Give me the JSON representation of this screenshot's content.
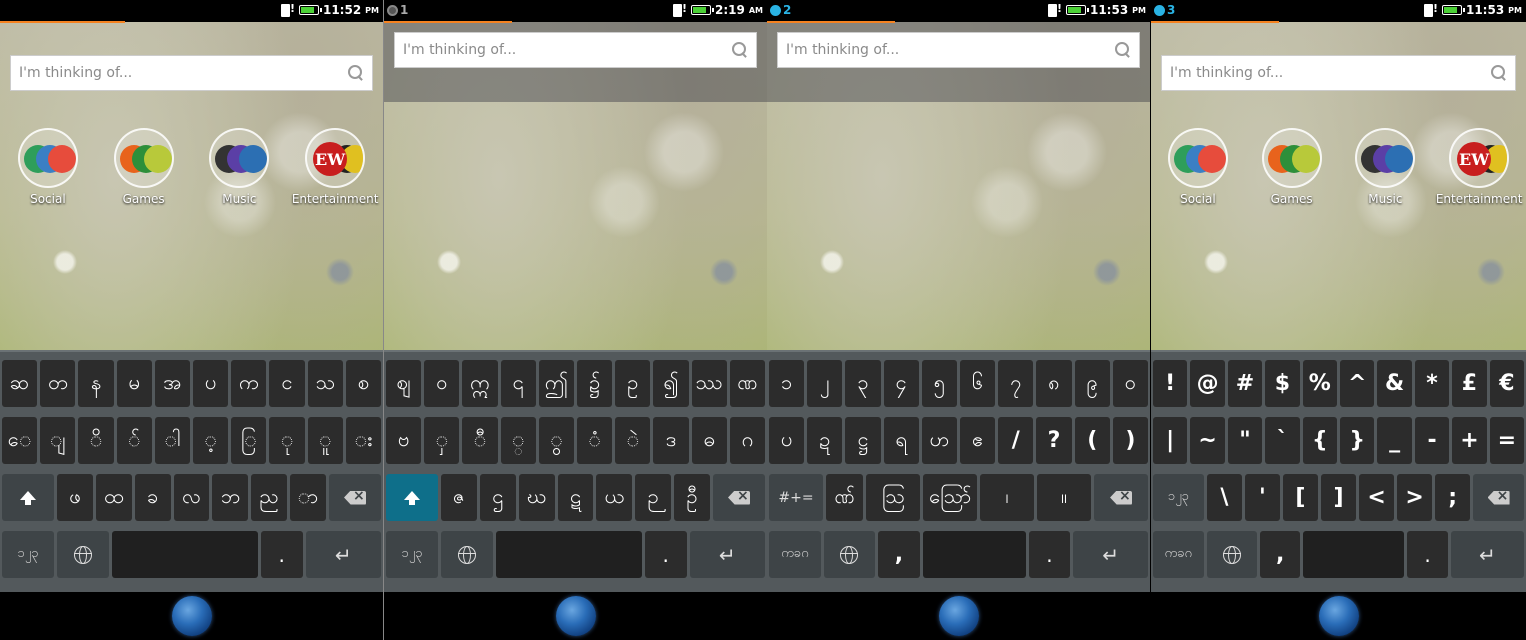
{
  "panels": [
    {
      "status": {
        "notif": "",
        "notif_style": "",
        "time": "11:52",
        "ampm": "PM"
      },
      "search_placeholder": "I'm thinking of...",
      "collections": [
        {
          "label": "Social"
        },
        {
          "label": "Games"
        },
        {
          "label": "Music"
        },
        {
          "label": "Entertainment"
        }
      ],
      "rows": [
        [
          "ဆ",
          "တ",
          "န",
          "မ",
          "အ",
          "ပ",
          "က",
          "င",
          "သ",
          "စ"
        ],
        [
          "ေ",
          "ျ",
          "ိ",
          "်",
          "ါ",
          "့",
          "ြ",
          "ု",
          "ူ",
          "း"
        ],
        [
          "shift",
          "ဖ",
          "ထ",
          "ခ",
          "လ",
          "ဘ",
          "ည",
          "ာ",
          "back"
        ],
        [
          "lang",
          "globe",
          "space",
          ".",
          "enter"
        ]
      ],
      "lang_label": "၁၂၃"
    },
    {
      "status": {
        "notif": "1",
        "notif_style": "gray",
        "time": "2:19",
        "ampm": "AM"
      },
      "search_placeholder": "I'm thinking of...",
      "rows": [
        [
          "ဈ",
          "ဝ",
          "ဣ",
          "၎",
          "ဤ",
          "၌",
          "ဥ",
          "၍",
          "ဿ",
          "ဏ"
        ],
        [
          "ဗ",
          "ှ",
          "ီ",
          "္",
          "ွ",
          "ံ",
          "ဲ",
          "ဒ",
          "ဓ",
          "ဂ"
        ],
        [
          "shift",
          "ဇ",
          "ဌ",
          "ဃ",
          "ဋ",
          "ယ",
          "ဉ",
          "ဦ",
          "back"
        ],
        [
          "lang",
          "globe",
          "space",
          ".",
          "enter"
        ]
      ],
      "lang_label": "၁၂၃"
    },
    {
      "status": {
        "notif": "2",
        "notif_style": "blue",
        "time": "11:53",
        "ampm": "PM"
      },
      "search_placeholder": "I'm thinking of...",
      "rows": [
        [
          "၁",
          "၂",
          "၃",
          "၄",
          "၅",
          "၆",
          "၇",
          "၈",
          "၉",
          "၀"
        ],
        [
          "ပ",
          "ဍ",
          "ဋ္ဌ",
          "ရ",
          "ဟ",
          "ဧ",
          "/",
          "?",
          "(",
          ")"
        ],
        [
          "#+=",
          "ဏ်",
          "ဩ",
          "ဪ",
          "၊",
          "။",
          "back"
        ],
        [
          "lang",
          ",",
          "globe",
          "space",
          ".",
          "enter"
        ]
      ],
      "lang_label": "ကခဂ",
      "sym_label": "#+="
    },
    {
      "status": {
        "notif": "3",
        "notif_style": "blue",
        "time": "11:53",
        "ampm": "PM"
      },
      "search_placeholder": "I'm thinking of...",
      "collections": [
        {
          "label": "Social"
        },
        {
          "label": "Games"
        },
        {
          "label": "Music"
        },
        {
          "label": "Entertainment"
        }
      ],
      "rows": [
        [
          "!",
          "@",
          "#",
          "$",
          "%",
          "^",
          "&",
          "*",
          "£",
          "€"
        ],
        [
          "|",
          "~",
          "\"",
          "`",
          "{",
          "}",
          "_",
          "-",
          "+",
          "="
        ],
        [
          "၁၂၃",
          "\\",
          "'",
          "[",
          "]",
          "<",
          ">",
          ";",
          "back"
        ],
        [
          "lang",
          ",",
          "globe",
          "space",
          ".",
          "enter"
        ]
      ],
      "lang_label": "ကခဂ"
    }
  ],
  "colors": {
    "accent": "#0e6f8a",
    "progress": "#f58220",
    "key": "#2c2c2c",
    "keyboard_bg": "#53595c"
  }
}
